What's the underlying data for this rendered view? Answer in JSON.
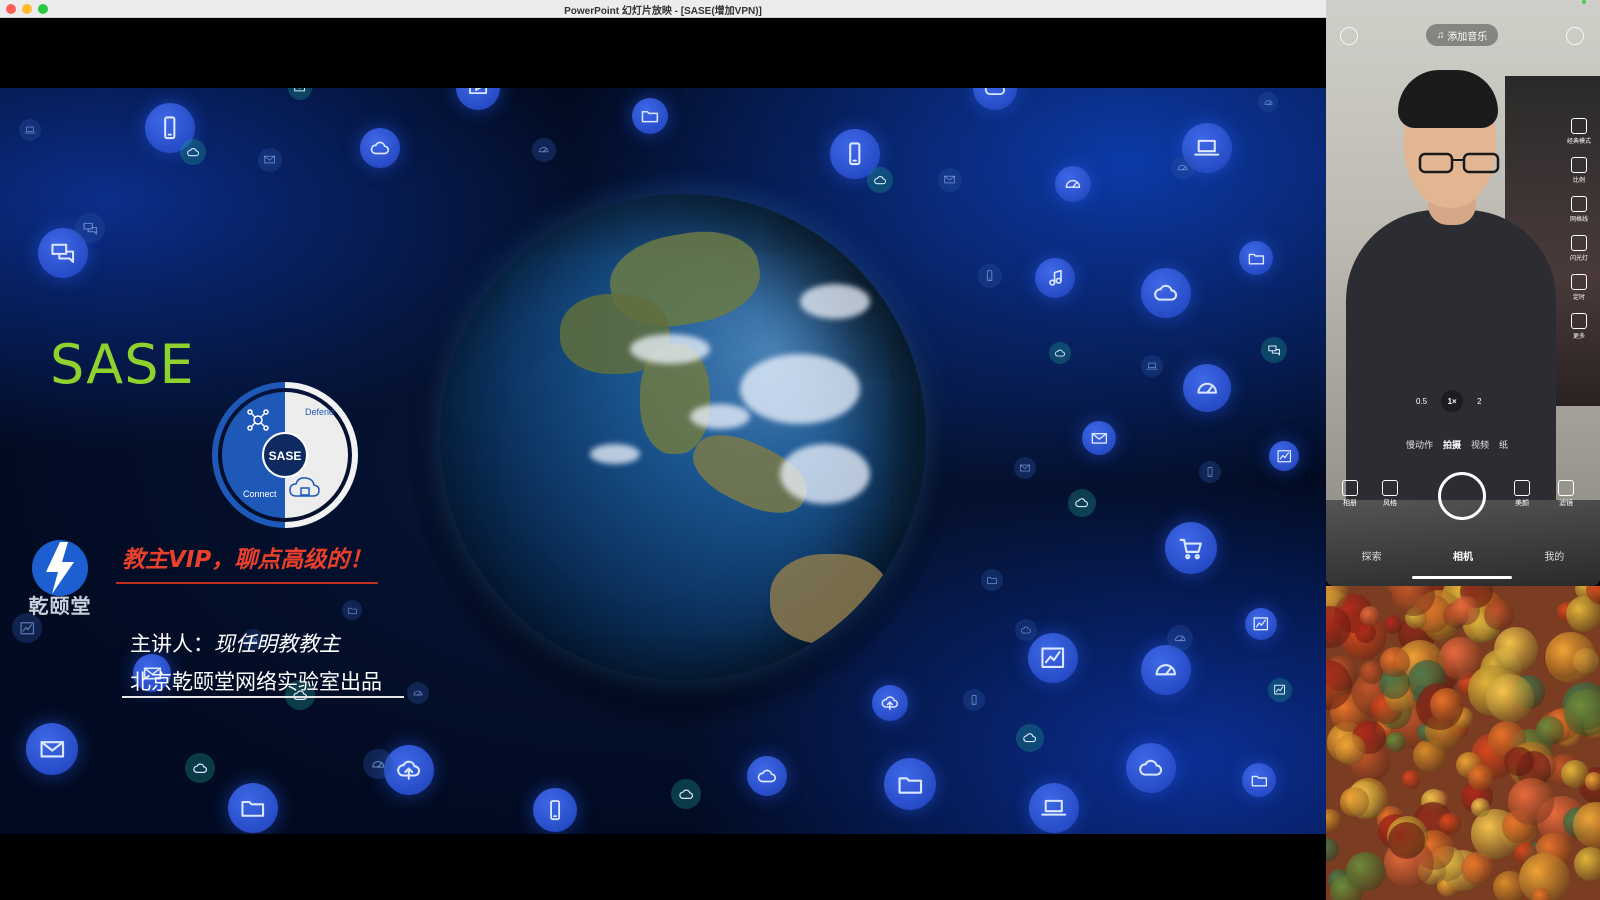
{
  "window": {
    "title": "PowerPoint 幻灯片放映 - [SASE(增加VPN)]"
  },
  "slide": {
    "sase_title": "SASE",
    "ring": {
      "center": "SASE",
      "top_label": "Defend",
      "bottom_label": "Connect"
    },
    "tagline": "教主VIP，聊点高级的！",
    "logo_text": "乾颐堂",
    "speaker_prefix": "主讲人：",
    "speaker_name": "现任明教教主",
    "producer": "北京乾颐堂网络实验室出品",
    "colors": {
      "sase": "#8fd22e",
      "tagline": "#e8402a",
      "ring_blue": "#1f59b8"
    }
  },
  "camera_app": {
    "add_music": "添加音乐",
    "side_tools": [
      "经典模式",
      "比例",
      "网格线",
      "闪光灯",
      "定时",
      "更多"
    ],
    "zoom_levels": [
      "0.5",
      "1×",
      "2"
    ],
    "active_zoom": "1×",
    "modes": [
      "慢动作",
      "拍摄",
      "视频",
      "纸"
    ],
    "active_mode": "拍摄",
    "bottom_tools": [
      "相册",
      "风格",
      "美颜",
      "滤镜"
    ],
    "tabs": [
      "探索",
      "相机",
      "我的"
    ],
    "active_tab": "相机"
  }
}
